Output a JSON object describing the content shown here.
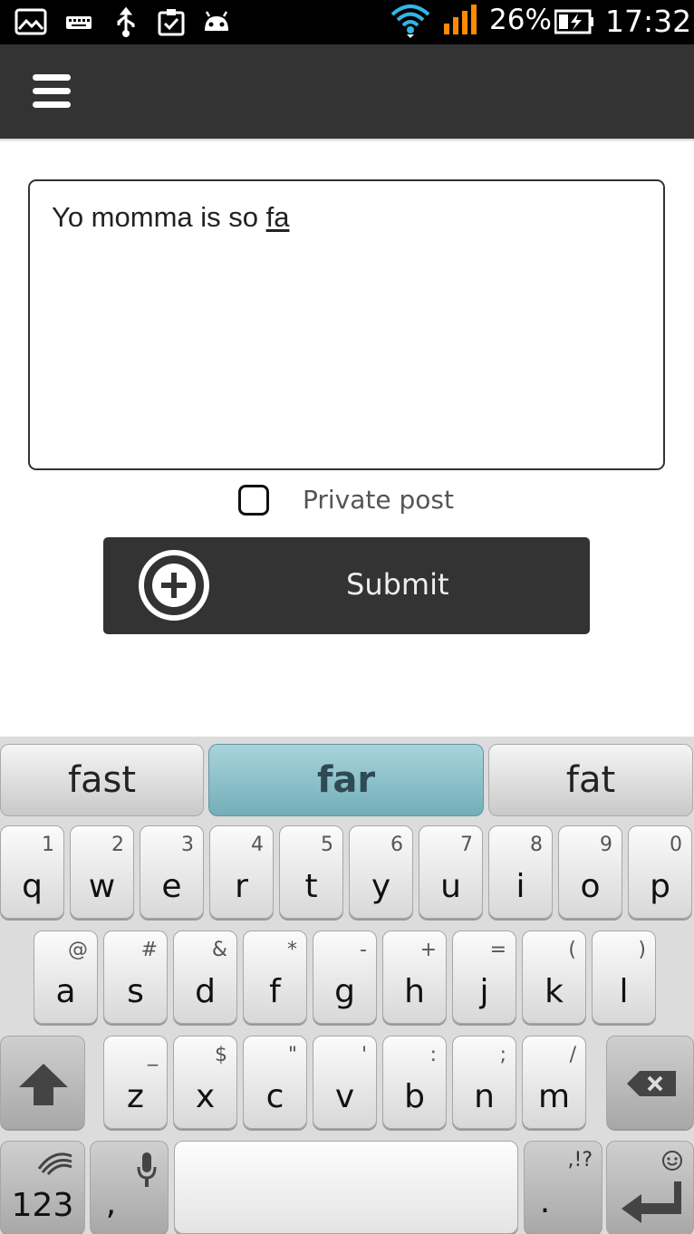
{
  "status_bar": {
    "battery": "26%",
    "time": "17:32",
    "icons": [
      "image-icon",
      "keyboard-icon",
      "usb-icon",
      "clipboard-icon",
      "android-icon",
      "wifi-icon",
      "signal-icon",
      "battery-icon"
    ]
  },
  "action_bar": {
    "menu_icon": "hamburger-menu-icon"
  },
  "form": {
    "post_text_committed": "Yo momma is so ",
    "post_text_composing": "fa",
    "private_label": "Private post",
    "private_checked": false,
    "submit_label": "Submit",
    "submit_icon": "plus-circle-icon"
  },
  "keyboard": {
    "suggestions": [
      "fast",
      "far",
      "fat"
    ],
    "row1": [
      {
        "main": "q",
        "sub": "1"
      },
      {
        "main": "w",
        "sub": "2"
      },
      {
        "main": "e",
        "sub": "3"
      },
      {
        "main": "r",
        "sub": "4"
      },
      {
        "main": "t",
        "sub": "5"
      },
      {
        "main": "y",
        "sub": "6"
      },
      {
        "main": "u",
        "sub": "7"
      },
      {
        "main": "i",
        "sub": "8"
      },
      {
        "main": "o",
        "sub": "9"
      },
      {
        "main": "p",
        "sub": "0"
      }
    ],
    "row2": [
      {
        "main": "a",
        "sub": "@"
      },
      {
        "main": "s",
        "sub": "#"
      },
      {
        "main": "d",
        "sub": "&"
      },
      {
        "main": "f",
        "sub": "*"
      },
      {
        "main": "g",
        "sub": "-"
      },
      {
        "main": "h",
        "sub": "+"
      },
      {
        "main": "j",
        "sub": "="
      },
      {
        "main": "k",
        "sub": "("
      },
      {
        "main": "l",
        "sub": ")"
      }
    ],
    "row3": [
      {
        "main": "z",
        "sub": "_"
      },
      {
        "main": "x",
        "sub": "$"
      },
      {
        "main": "c",
        "sub": "\""
      },
      {
        "main": "v",
        "sub": "'"
      },
      {
        "main": "b",
        "sub": ":"
      },
      {
        "main": "n",
        "sub": ";"
      },
      {
        "main": "m",
        "sub": "/"
      }
    ],
    "numbers_label": "123",
    "comma_label": ",",
    "period_label": ".",
    "period_sub": ",!?"
  },
  "colors": {
    "status_bar": "#000000",
    "action_bar": "#333333",
    "wifi": "#33b5e5",
    "signal": "#ff8a00",
    "suggestion_active": "#8ec3cc"
  }
}
